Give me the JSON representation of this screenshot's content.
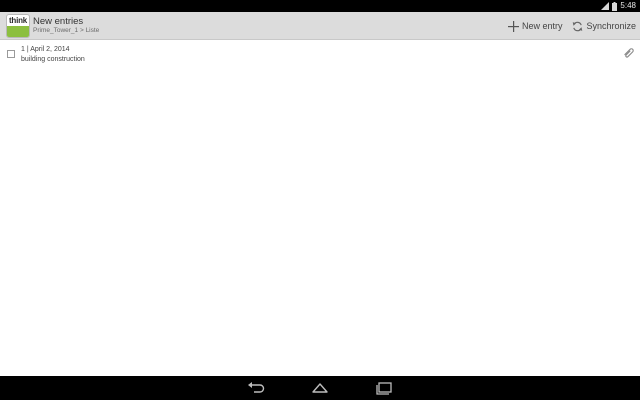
{
  "status_bar": {
    "time": "5:48",
    "icons": [
      "signal-icon",
      "battery-icon"
    ]
  },
  "app": {
    "logo_text": "think",
    "logo_subtext": "",
    "title": "New entries",
    "breadcrumb": "Prime_Tower_1 > Liste"
  },
  "actions": {
    "new_entry_label": "New entry",
    "synchronize_label": "Synchronize"
  },
  "entries": [
    {
      "number_date": "1 | April 2, 2014",
      "description": "building construction",
      "checked": false,
      "has_attachment": true
    }
  ],
  "navigation": {
    "icons": [
      "back-icon",
      "home-icon",
      "recents-icon"
    ]
  },
  "colors": {
    "action_bar": "#dcdcdc",
    "logo_green": "#8cbf3f",
    "system_bars": "#000000"
  }
}
